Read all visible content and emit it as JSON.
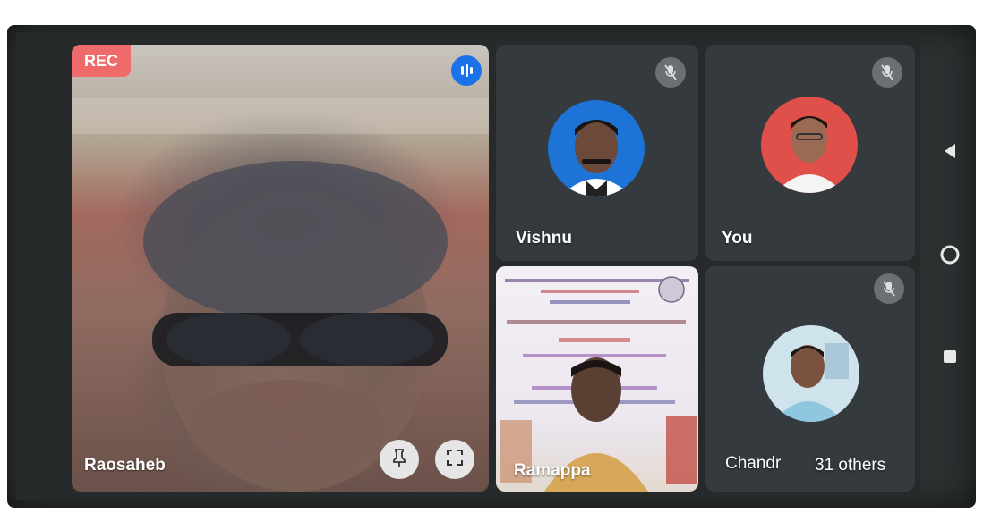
{
  "call": {
    "rec_label": "REC",
    "main_participant": "Raosaheb",
    "participants": [
      {
        "name": "Vishnu",
        "muted": true
      },
      {
        "name": "You",
        "muted": true
      },
      {
        "name": "Ramappa",
        "muted": false
      },
      {
        "name": "Chandr",
        "muted": true
      }
    ],
    "others_label": "31 others"
  },
  "colors": {
    "rec": "#ef6b6b",
    "audio_active": "#1a73e8",
    "tile_bg": "#343a3d",
    "screen_bg": "#262a2b"
  },
  "icons": {
    "audio_active": "audio-wave-icon",
    "pin": "pin-icon",
    "fullscreen": "fullscreen-icon",
    "mic_off": "mic-off-icon",
    "nav_back": "back-triangle-icon",
    "nav_home": "home-circle-icon",
    "nav_recents": "recents-square-icon"
  }
}
